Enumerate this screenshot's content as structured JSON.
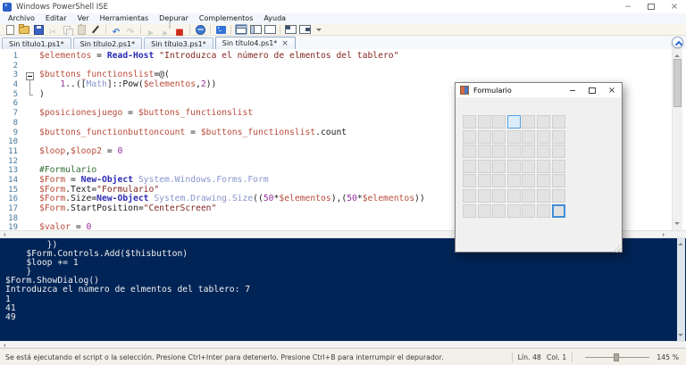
{
  "window": {
    "title": "Windows PowerShell ISE"
  },
  "menu": {
    "items": [
      "Archivo",
      "Editar",
      "Ver",
      "Herramientas",
      "Depurar",
      "Complementos",
      "Ayuda"
    ]
  },
  "toolbar": {
    "items": [
      {
        "name": "new-script",
        "icon": "new"
      },
      {
        "name": "open-script",
        "icon": "open"
      },
      {
        "name": "save-script",
        "icon": "save"
      },
      {
        "name": "cut",
        "icon": "cut",
        "disabled": true
      },
      {
        "name": "copy",
        "icon": "copy",
        "disabled": true
      },
      {
        "name": "paste",
        "icon": "paste",
        "disabled": true
      },
      {
        "name": "clear-console-pane",
        "icon": "clear"
      },
      {
        "sep": true
      },
      {
        "name": "undo",
        "icon": "undo"
      },
      {
        "name": "redo",
        "icon": "redo",
        "disabled": true
      },
      {
        "sep": true
      },
      {
        "name": "run-script",
        "icon": "run",
        "disabled": true
      },
      {
        "name": "run-selection",
        "icon": "runsel",
        "disabled": true
      },
      {
        "name": "stop-operation",
        "icon": "stop"
      },
      {
        "sep": true
      },
      {
        "name": "new-remote-powershell-tab",
        "icon": "remote"
      },
      {
        "sep": true
      },
      {
        "name": "start-powershell",
        "icon": "ps"
      },
      {
        "sep": true
      },
      {
        "name": "show-script-pane-top",
        "icon": "lay-top",
        "active": true
      },
      {
        "name": "show-script-pane-right",
        "icon": "lay-side"
      },
      {
        "name": "show-script-pane-maximized",
        "icon": "lay-full"
      },
      {
        "sep": true
      },
      {
        "name": "show-command-add-on",
        "icon": "pane1"
      },
      {
        "name": "show-command-window",
        "icon": "pane2"
      },
      {
        "name": "toolbar-overflow",
        "icon": "more"
      }
    ]
  },
  "tabs": {
    "close_glyph": "×",
    "items": [
      {
        "label": "Sin título1.ps1*"
      },
      {
        "label": "Sin título2.ps1*"
      },
      {
        "label": "Sin título3.ps1*"
      },
      {
        "label": "Sin título4.ps1*",
        "active": true,
        "closable": true
      }
    ]
  },
  "editor": {
    "lines": [
      {
        "n": 1,
        "segs": [
          [
            "v",
            "$elementos"
          ],
          [
            "p",
            " = "
          ],
          [
            "c",
            "Read-Host"
          ],
          [
            "p",
            " "
          ],
          [
            "s",
            "\"Introduzca el número de elmentos del tablero\""
          ]
        ]
      },
      {
        "n": 2,
        "segs": []
      },
      {
        "n": 3,
        "fold": "start",
        "segs": [
          [
            "v",
            "$buttons_functionslist"
          ],
          [
            "p",
            "=@("
          ]
        ]
      },
      {
        "n": 4,
        "fold": "mid",
        "segs": [
          [
            "p",
            "    "
          ],
          [
            "n",
            "1"
          ],
          [
            "p",
            "..(["
          ],
          [
            "t",
            "Math"
          ],
          [
            "p",
            "]::Pow("
          ],
          [
            "v",
            "$elementos"
          ],
          [
            "p",
            ","
          ],
          [
            "n",
            "2"
          ],
          [
            "p",
            "))"
          ]
        ]
      },
      {
        "n": 5,
        "fold": "end",
        "segs": [
          [
            "p",
            ")"
          ]
        ]
      },
      {
        "n": 6,
        "segs": []
      },
      {
        "n": 7,
        "segs": [
          [
            "v",
            "$posicionesjuego"
          ],
          [
            "p",
            " = "
          ],
          [
            "v",
            "$buttons_functionslist"
          ]
        ]
      },
      {
        "n": 8,
        "segs": []
      },
      {
        "n": 9,
        "segs": [
          [
            "v",
            "$buttons_functionbuttoncount"
          ],
          [
            "p",
            " = "
          ],
          [
            "v",
            "$buttons_functionslist"
          ],
          [
            "p",
            ".count"
          ]
        ]
      },
      {
        "n": 10,
        "segs": []
      },
      {
        "n": 11,
        "segs": [
          [
            "v",
            "$loop"
          ],
          [
            "p",
            ","
          ],
          [
            "v",
            "$loop2"
          ],
          [
            "p",
            " = "
          ],
          [
            "n",
            "0"
          ]
        ]
      },
      {
        "n": 12,
        "segs": []
      },
      {
        "n": 13,
        "segs": [
          [
            "cm",
            "#Formulario"
          ]
        ]
      },
      {
        "n": 14,
        "segs": [
          [
            "v",
            "$Form"
          ],
          [
            "p",
            " = "
          ],
          [
            "c",
            "New-Object"
          ],
          [
            "p",
            " "
          ],
          [
            "t",
            "System.Windows.Forms.Form"
          ]
        ]
      },
      {
        "n": 15,
        "segs": [
          [
            "v",
            "$Form"
          ],
          [
            "p",
            ".Text="
          ],
          [
            "s",
            "\"Formulario\""
          ]
        ]
      },
      {
        "n": 16,
        "segs": [
          [
            "v",
            "$Form"
          ],
          [
            "p",
            ".Size="
          ],
          [
            "c",
            "New-Object"
          ],
          [
            "p",
            " "
          ],
          [
            "t",
            "System.Drawing.Size"
          ],
          [
            "p",
            "(("
          ],
          [
            "n",
            "50"
          ],
          [
            "p",
            "*"
          ],
          [
            "v",
            "$elementos"
          ],
          [
            "p",
            "),("
          ],
          [
            "n",
            "50"
          ],
          [
            "p",
            "*"
          ],
          [
            "v",
            "$elementos"
          ],
          [
            "p",
            "))"
          ]
        ]
      },
      {
        "n": 17,
        "segs": [
          [
            "v",
            "$Form"
          ],
          [
            "p",
            ".StartPosition="
          ],
          [
            "s",
            "\"CenterScreen\""
          ]
        ]
      },
      {
        "n": 18,
        "segs": []
      },
      {
        "n": 19,
        "segs": [
          [
            "v",
            "$valor"
          ],
          [
            "p",
            " = "
          ],
          [
            "n",
            "0"
          ]
        ]
      }
    ]
  },
  "console": {
    "lines": [
      "        })",
      "    $Form.Controls.Add($thisbutton)",
      "    $loop += 1",
      "    }",
      "$Form.ShowDialog()",
      "Introduzca el número de elmentos del tablero: 7",
      "1",
      "41",
      "49"
    ]
  },
  "status": {
    "message": "Se está ejecutando el script o la selección. Presione Ctrl+Inter para detenerlo. Presione Ctrl+B para interrumpir el depurador.",
    "line_label": "Lín. 48",
    "col_label": "Col. 1",
    "zoom": "145 %"
  },
  "dialog": {
    "title": "Formulario",
    "grid": {
      "rows": 7,
      "cols": 7,
      "hover_cell": [
        0,
        3
      ],
      "focus_cell": [
        6,
        6
      ]
    }
  },
  "colors": {
    "console_bg": "#012456",
    "accent_blue": "#3e8ed9",
    "stop_red": "#cf2b1d"
  }
}
